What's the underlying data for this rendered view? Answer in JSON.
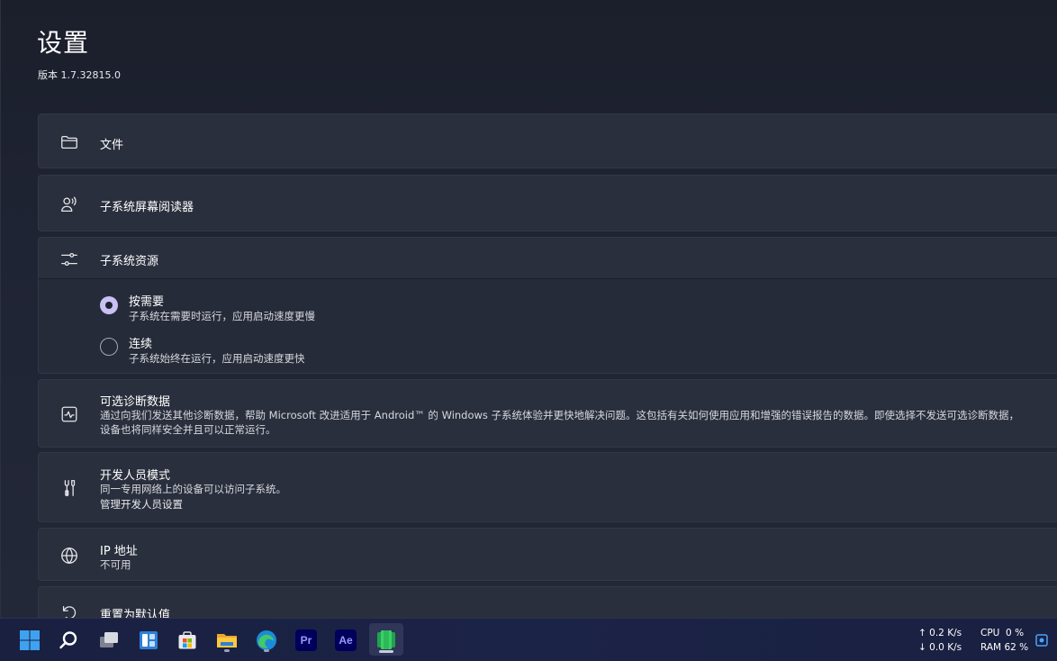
{
  "header": {
    "title": "设置",
    "version": "版本 1.7.32815.0"
  },
  "settings": {
    "files": {
      "label": "文件",
      "icon": "folder-icon"
    },
    "screen_reader": {
      "label": "子系统屏幕阅读器",
      "icon": "screen-reader-icon"
    },
    "resources": {
      "label": "子系统资源",
      "icon": "sliders-icon",
      "options": [
        {
          "title": "按需要",
          "desc": "子系统在需要时运行，应用启动速度更慢",
          "selected": true
        },
        {
          "title": "连续",
          "desc": "子系统始终在运行，应用启动速度更快",
          "selected": false
        }
      ]
    },
    "diagnostics": {
      "label": "可选诊断数据",
      "icon": "activity-icon",
      "desc_line1": "通过向我们发送其他诊断数据，帮助 Microsoft 改进适用于 Android™ 的 Windows 子系统体验并更快地解决问题。这包括有关如何使用应用和增强的错误报告的数据。即使选择不发送可选诊断数据，",
      "desc_line2": "设备也将同样安全并且可以正常运行。"
    },
    "developer": {
      "label": "开发人员模式",
      "icon": "tools-icon",
      "desc": "同一专用网络上的设备可以访问子系统。",
      "link": "管理开发人员设置"
    },
    "ip": {
      "label": "IP 地址",
      "icon": "globe-icon",
      "value": "不可用"
    },
    "reset": {
      "label": "重置为默认值",
      "icon": "reset-icon"
    }
  },
  "taskbar": {
    "apps": [
      "windows-start",
      "search",
      "task-view",
      "widgets",
      "store",
      "file-explorer",
      "edge",
      "premiere-pro",
      "after-effects",
      "wsa-settings"
    ],
    "premiere_label": "Pr",
    "ae_label": "Ae",
    "net_up": "0.2 K/s",
    "net_down": "0.0 K/s",
    "cpu_label": "CPU",
    "cpu_value": "0 %",
    "ram_label": "RAM",
    "ram_value": "62 %"
  },
  "colors": {
    "accent": "#c9c1f2",
    "card": "#2a2f3d",
    "taskbar": "#1b2347"
  }
}
